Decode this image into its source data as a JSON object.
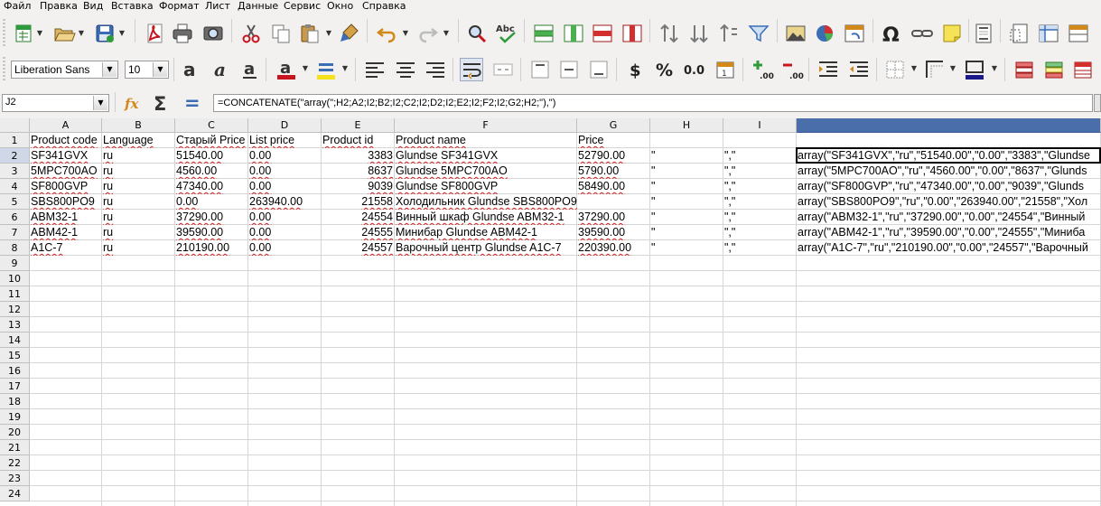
{
  "menu": [
    "Файл",
    "Правка",
    "Вид",
    "Вставка",
    "Формат",
    "Лист",
    "Данные",
    "Сервис",
    "Окно",
    "Справка"
  ],
  "font_name": "Liberation Sans",
  "font_size": "10",
  "name_box": "J2",
  "formula": "=CONCATENATE(\"array(\";H2;A2;I2;B2;I2;C2;I2;D2;I2;E2;I2;F2;I2;G2;H2;\"),\")",
  "colors": {
    "selection_header": "#4a6ea9",
    "spell_error": "#d02020",
    "grid_line": "#d6d6d6"
  },
  "columns": [
    "A",
    "B",
    "C",
    "D",
    "E",
    "F",
    "G",
    "H",
    "I",
    ""
  ],
  "rows": [
    "1",
    "2",
    "3",
    "4",
    "5",
    "6",
    "7",
    "8",
    "9",
    "10",
    "11",
    "12",
    "13",
    "14",
    "15",
    "16",
    "17",
    "18",
    "19",
    "20",
    "21",
    "22",
    "23",
    "24"
  ],
  "header_row": [
    "Product code",
    "Language",
    "Старый Price",
    "List price",
    "Product id",
    "Product name",
    "Price",
    "",
    "",
    ""
  ],
  "data_rows": [
    [
      "SF341GVX",
      "ru",
      "51540.00",
      "0.00",
      "3383",
      "Glundse SF341GVX",
      "52790.00",
      "\"",
      "\",\"",
      "array(\"SF341GVX\",\"ru\",\"51540.00\",\"0.00\",\"3383\",\"Glundse"
    ],
    [
      "5MPC700AO",
      "ru",
      "4560.00",
      "0.00",
      "8637",
      "Glundse 5MPC700AO",
      "5790.00",
      "\"",
      "\",\"",
      "array(\"5MPC700AO\",\"ru\",\"4560.00\",\"0.00\",\"8637\",\"Glunds"
    ],
    [
      "SF800GVP",
      "ru",
      "47340.00",
      "0.00",
      "9039",
      "Glundse SF800GVP",
      "58490.00",
      "\"",
      "\",\"",
      "array(\"SF800GVP\",\"ru\",\"47340.00\",\"0.00\",\"9039\",\"Glunds"
    ],
    [
      "SBS800PO9",
      "ru",
      "0.00",
      "263940.00",
      "21558",
      "Холодильник Glundse SBS800PO9",
      "",
      "\"",
      "\",\"",
      "array(\"SBS800PO9\",\"ru\",\"0.00\",\"263940.00\",\"21558\",\"Хол"
    ],
    [
      "ABM32-1",
      "ru",
      "37290.00",
      "0.00",
      "24554",
      "Винный шкаф Glundse ABM32-1",
      "37290.00",
      "\"",
      "\",\"",
      "array(\"ABM32-1\",\"ru\",\"37290.00\",\"0.00\",\"24554\",\"Винный"
    ],
    [
      "ABM42-1",
      "ru",
      "39590.00",
      "0.00",
      "24555",
      "Минибар Glundse ABM42-1",
      "39590.00",
      "\"",
      "\",\"",
      "array(\"ABM42-1\",\"ru\",\"39590.00\",\"0.00\",\"24555\",\"Миниба"
    ],
    [
      "A1C-7",
      "ru",
      "210190.00",
      "0.00",
      "24557",
      "Варочный центр Glundse A1C-7",
      "220390.00",
      "\"",
      "\",\"",
      "array(\"A1C-7\",\"ru\",\"210190.00\",\"0.00\",\"24557\",\"Варочный"
    ]
  ],
  "numeric_columns": [
    4
  ],
  "spell_columns": [
    0,
    1,
    2,
    3,
    4,
    5,
    6
  ],
  "active_cell": {
    "row": 2,
    "col": 9
  },
  "toolbar_icons": {
    "standard": [
      "new-doc-icon",
      "open-icon",
      "save-icon",
      "pdf-export-icon",
      "print-icon",
      "print-preview-icon",
      "cut-icon",
      "copy-icon",
      "paste-icon",
      "clone-formatting-icon",
      "undo-icon",
      "redo-icon",
      "find-replace-icon",
      "spellcheck-icon",
      "insert-row-icon",
      "insert-column-icon",
      "delete-row-icon",
      "delete-column-icon",
      "sort-icon",
      "sort-ascending-icon",
      "sort-descending-icon",
      "autofilter-icon",
      "insert-image-icon",
      "insert-chart-icon",
      "pivot-table-icon",
      "special-character-icon",
      "hyperlink-icon",
      "comment-icon",
      "header-footer-icon",
      "define-print-area-icon",
      "freeze-rows-columns-icon",
      "split-window-icon"
    ],
    "formatting": [
      "bold-icon",
      "italic-icon",
      "underline-icon",
      "font-color-icon",
      "highlight-icon",
      "align-left-icon",
      "align-center-icon",
      "align-right-icon",
      "wrap-text-icon",
      "merge-cells-icon",
      "align-top-icon",
      "align-middle-icon",
      "align-bottom-icon",
      "currency-icon",
      "percent-icon",
      "number-format-icon",
      "date-format-icon",
      "add-decimal-icon",
      "delete-decimal-icon",
      "increase-indent-icon",
      "decrease-indent-icon",
      "borders-icon",
      "border-style-icon",
      "border-color-icon",
      "conditional-format-icon",
      "styles-icon",
      "autoformat-icon"
    ]
  },
  "glyphs": {
    "currency": "$",
    "percent": "%",
    "number": "0.0",
    "omega": "Ω",
    "sigma": "Σ",
    "equals": "=",
    "fx": "fx",
    "abc": "Abc",
    "bold": "a",
    "date_day": "1"
  }
}
